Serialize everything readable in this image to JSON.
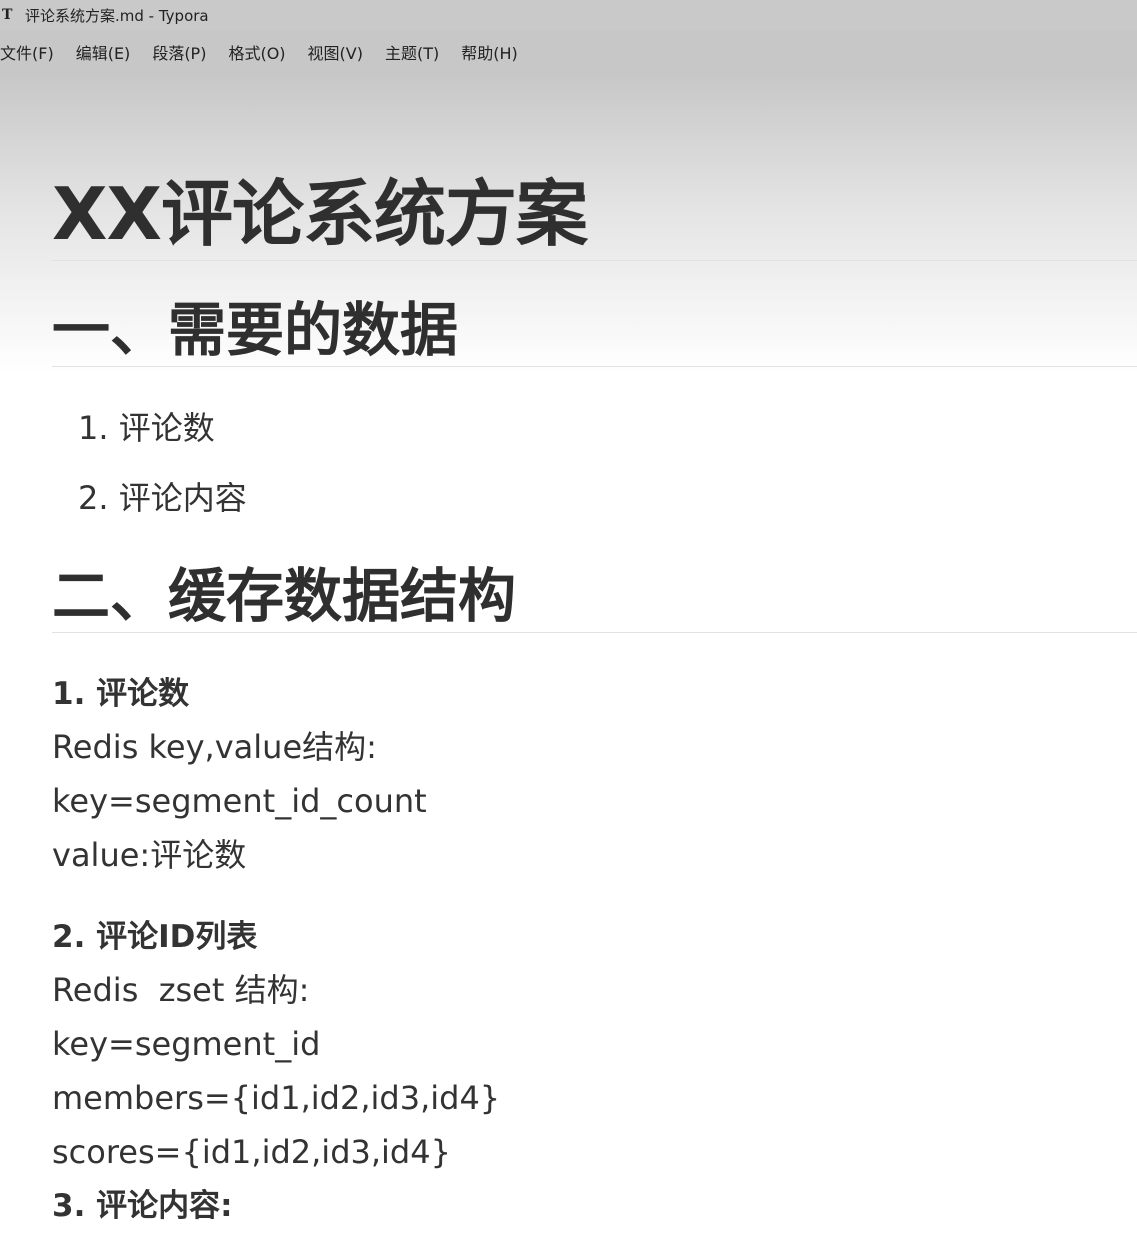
{
  "window": {
    "app_icon": "T",
    "title": "评论系统方案.md - Typora"
  },
  "menu": [
    "文件(F)",
    "编辑(E)",
    "段落(P)",
    "格式(O)",
    "视图(V)",
    "主题(T)",
    "帮助(H)"
  ],
  "doc": {
    "title": "XX评论系统方案",
    "section1": {
      "heading": "一、需要的数据",
      "items": [
        "1. 评论数",
        "2. 评论内容"
      ]
    },
    "section2": {
      "heading": "二、缓存数据结构",
      "sub1": {
        "heading": "1. 评论数",
        "lines": [
          "Redis key,value结构:",
          "key=segment_id_count",
          "value:评论数"
        ]
      },
      "sub2": {
        "heading": "2. 评论ID列表",
        "lines": [
          "Redis  zset 结构:",
          "key=segment_id",
          "members={id1,id2,id3,id4}",
          "scores={id1,id2,id3,id4}"
        ]
      },
      "sub3": {
        "heading": "3. 评论内容:"
      }
    }
  }
}
